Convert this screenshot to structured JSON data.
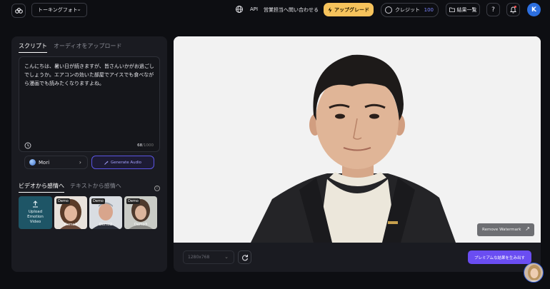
{
  "topbar": {
    "mode_label": "トーキングフォト",
    "api_label": "API",
    "contact_label": "営業担当へ問い合わせる",
    "upgrade_label": "アップグレード",
    "credit_label": "クレジット",
    "credit_value": "100",
    "results_label": "結果一覧",
    "help_label": "?",
    "avatar_initial": "K"
  },
  "script_panel": {
    "tabs": [
      "スクリプト",
      "オーディオをアップロード"
    ],
    "script_text": "こんにちは、暑い日が続きますが、皆さんいかがお過ごしでしょうか。エアコンの効いた部屋でアイスでも食べながら漫画でも読みたくなりますよね。",
    "char_count": "68",
    "char_limit": "/1000",
    "voice_name": "Mori",
    "generate_audio_label": "Generate Audio"
  },
  "emotion_panel": {
    "tabs": [
      "ビデオから感情へ",
      "テキストから感情へ"
    ],
    "upload_label": "Upload Emotion Video",
    "demos": [
      {
        "badge": "Demo",
        "label": "Demo1"
      },
      {
        "badge": "Demo",
        "label": "Demo2"
      },
      {
        "badge": "Demo",
        "label": "Demo3"
      }
    ]
  },
  "preview_panel": {
    "remove_watermark_label": "Remove Watermark",
    "resolution": "1280x768",
    "generate_result_label": "プレミアムな結果を生み出す"
  },
  "colors": {
    "accent": "#6a4df2",
    "upgrade": "#f6c35c",
    "avatar": "#2c6fe0"
  }
}
